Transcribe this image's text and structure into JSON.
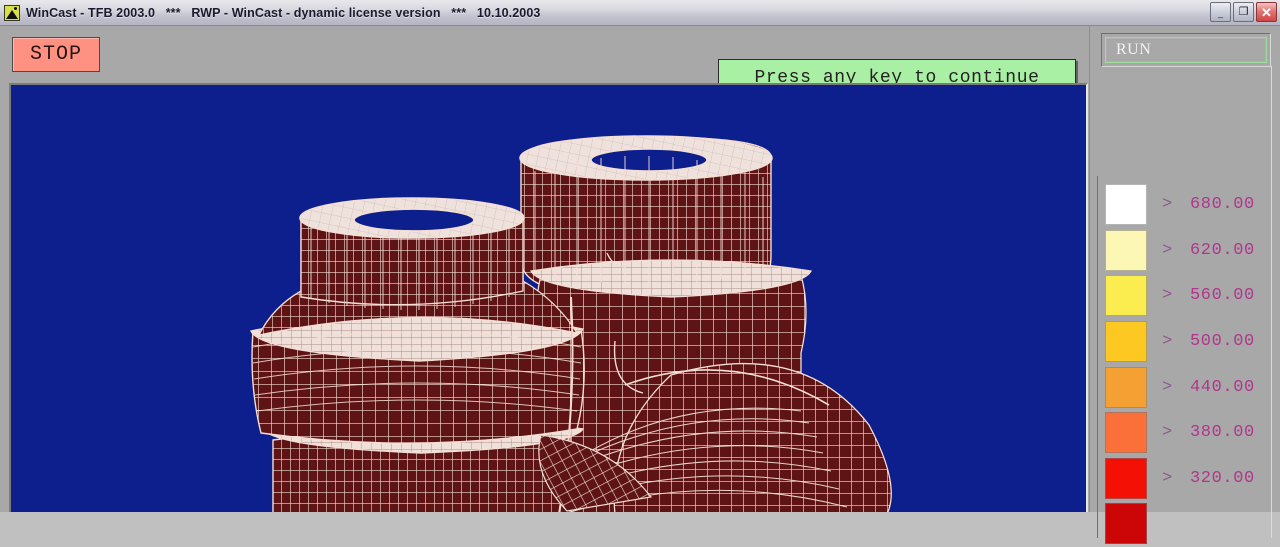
{
  "window": {
    "title": "WinCast - TFB 2003.0   ***   RWP - WinCast - dynamic license version   ***   10.10.2003",
    "app_icon_name": "wincast-app-icon",
    "buttons": {
      "minimize_label": "_",
      "restore_label": "❐",
      "close_label": "✕"
    }
  },
  "toolbar": {
    "stop_label": "STOP",
    "stop_color": "#ff9183",
    "message": "Press any key to continue",
    "message_bg": "#a9f0a4"
  },
  "viewport": {
    "background_color": "#0d1f8c",
    "mesh_fill_color": "#5e1414",
    "mesh_line_color": "#f7e4db",
    "model_description": "wireframe-mesh-casting-part"
  },
  "right_panel": {
    "status_label": "RUN",
    "status_border_color": "#9ae09a",
    "legend_title": "",
    "legend": [
      {
        "color": "#ffffff",
        "op": ">",
        "value": "680.00"
      },
      {
        "color": "#fdf7b5",
        "op": ">",
        "value": "620.00"
      },
      {
        "color": "#fbec4f",
        "op": ">",
        "value": "560.00"
      },
      {
        "color": "#fdc821",
        "op": ">",
        "value": "500.00"
      },
      {
        "color": "#f5a033",
        "op": ">",
        "value": "440.00"
      },
      {
        "color": "#fa7038",
        "op": ">",
        "value": "380.00"
      },
      {
        "color": "#f41005",
        "op": ">",
        "value": "320.00"
      },
      {
        "color": "#cc0606",
        "op": ">",
        "value": ""
      }
    ]
  }
}
